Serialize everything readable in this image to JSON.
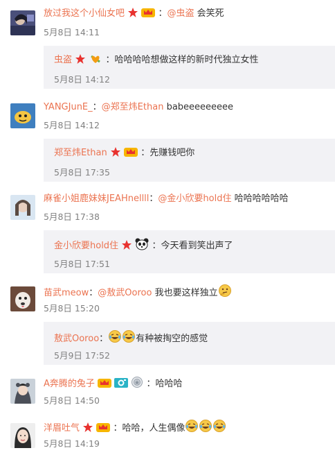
{
  "comments": [
    {
      "username": "放过我这个小仙女吧",
      "mention": "@虫盗",
      "text": "会笑死",
      "time": "5月8日 14:11",
      "reply": {
        "username": "虫盗",
        "text": "哈哈哈哈想做这样的新时代独立女性",
        "time": "5月8日 14:12"
      }
    },
    {
      "username": "YANGJunE_",
      "mention": "@郑至炜Ethan",
      "text": "babeeeeeeeee",
      "time": "5月8日 14:12",
      "reply": {
        "username": "郑至炜Ethan",
        "text": "先赚钱吧你",
        "time": "5月8日 17:35"
      }
    },
    {
      "username": "麻雀小姐鹿妹妹JEAHnellll",
      "mention": "@金小欣要hold住",
      "text": "哈哈哈哈哈哈",
      "time": "5月8日 17:38",
      "reply": {
        "username": "金小欣要hold住",
        "text": "今天看到笑出声了",
        "time": "5月8日 17:51"
      }
    },
    {
      "username": "苗武meow",
      "mention": "@敖武Ooroo",
      "text": "我也要这样独立",
      "time": "5月8日 15:20",
      "reply": {
        "username": "敖武Ooroo",
        "text": "有种被掏空的感觉",
        "time": "5月9日 17:52"
      }
    },
    {
      "username": "A奔腾的兔子",
      "text": "哈哈哈",
      "time": "5月8日 14:50"
    },
    {
      "username": "洋眉吐气",
      "text": "哈哈，人生偶像",
      "time": "5月8日 14:19"
    }
  ],
  "colors": {
    "username": "#eb7350",
    "text": "#333333",
    "time": "#808080",
    "reply_bg": "#f2f2f5",
    "star_badge": "#e8322f"
  },
  "icons": [
    "star-badge-icon",
    "crown-badge-icon",
    "heart-badge-icon",
    "panda-icon",
    "camera-badge-icon",
    "medal-icon",
    "laughing-emoji-icon",
    "thinking-emoji-icon"
  ]
}
